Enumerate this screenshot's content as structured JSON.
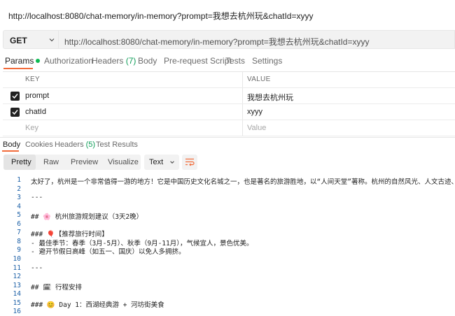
{
  "page_title": "http://localhost:8080/chat-memory/in-memory?prompt=我想去杭州玩&chatId=xyyy",
  "request": {
    "method": "GET",
    "url": "http://localhost:8080/chat-memory/in-memory?prompt=我想去杭州玩&chatId=xyyy"
  },
  "request_tabs": {
    "params": "Params",
    "auth": "Authorization",
    "headers": "Headers",
    "headers_count": "(7)",
    "body": "Body",
    "prerequest": "Pre-request Script",
    "tests": "Tests",
    "settings": "Settings"
  },
  "params_table": {
    "key_header": "KEY",
    "value_header": "VALUE",
    "rows": [
      {
        "key": "prompt",
        "value": "我想去杭州玩",
        "checked": true
      },
      {
        "key": "chatId",
        "value": "xyyy",
        "checked": true
      }
    ],
    "key_placeholder": "Key",
    "value_placeholder": "Value"
  },
  "response_tabs": {
    "body": "Body",
    "cookies": "Cookies",
    "headers": "Headers",
    "headers_count": "(5)",
    "test_results": "Test Results"
  },
  "view_modes": {
    "pretty": "Pretty",
    "raw": "Raw",
    "preview": "Preview",
    "visualize": "Visualize"
  },
  "format": "Text",
  "lines": [
    {
      "n": "1",
      "t": "太好了，杭州是一个非常值得一游的地方！它是中国历史文化名城之一，也是著名的旅游胜地，以“人间天堂”著称。杭州的自然风光、人文古迹、美食与休闲"
    },
    {
      "n": "2",
      "t": ""
    },
    {
      "n": "3",
      "t": "---"
    },
    {
      "n": "4",
      "t": ""
    },
    {
      "n": "5",
      "t": "## 🌸 杭州旅游规划建议（3天2晚）"
    },
    {
      "n": "6",
      "t": ""
    },
    {
      "n": "7",
      "t": "### 🎈【推荐旅行时间】"
    },
    {
      "n": "8",
      "t": "- 最佳季节：春季（3月-5月）、秋季（9月-11月），气候宜人，景色优美。"
    },
    {
      "n": "9",
      "t": "- 避开节假日高峰（如五一、国庆）以免人多拥挤。"
    },
    {
      "n": "10",
      "t": ""
    },
    {
      "n": "11",
      "t": "---"
    },
    {
      "n": "12",
      "t": ""
    },
    {
      "n": "13",
      "t": "## 🗓 行程安排"
    },
    {
      "n": "14",
      "t": ""
    },
    {
      "n": "15",
      "t": "### 😊 Day 1：西湖经典游 + 河坊街美食"
    },
    {
      "n": "16",
      "t": ""
    }
  ],
  "colors": {
    "accent": "#f26b3a",
    "status_dot": "#0cbb52",
    "line_numbers": "#1b5fa6"
  }
}
